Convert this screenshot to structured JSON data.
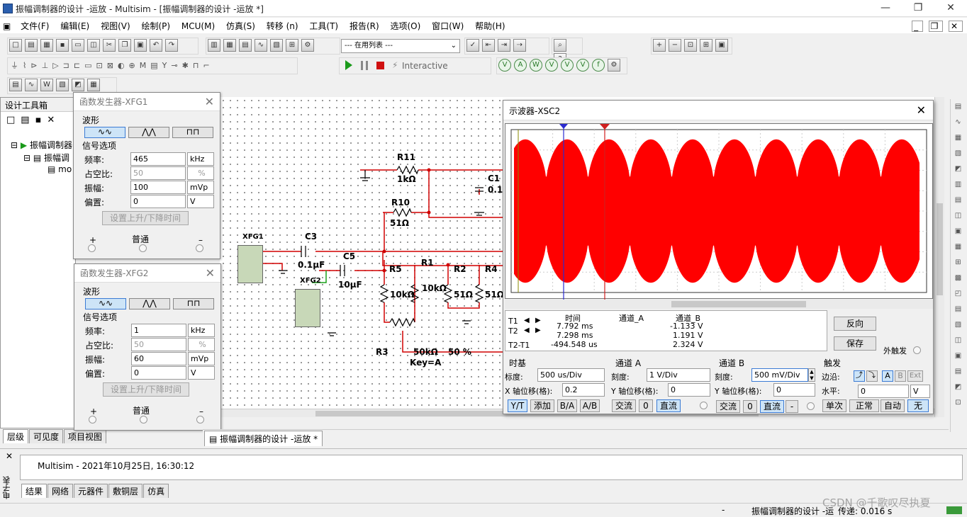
{
  "app": {
    "title": "振幅调制器的设计 -运放 - Multisim - [振幅调制器的设计 -运放 *]"
  },
  "menu": [
    "文件(F)",
    "编辑(E)",
    "视图(V)",
    "绘制(P)",
    "MCU(M)",
    "仿真(S)",
    "转移 (n)",
    "工具(T)",
    "报告(R)",
    "选项(O)",
    "窗口(W)",
    "帮助(H)"
  ],
  "toolbar": {
    "list_select": "--- 在用列表 ---",
    "interactive": "Interactive"
  },
  "left_panel": {
    "title": "设计工具箱",
    "tree": [
      "振幅调制器",
      "振幅调",
      "mo"
    ],
    "tabs": [
      "层级",
      "可见度",
      "项目视图"
    ]
  },
  "xfg1": {
    "title": "函数发生器-XFG1",
    "waveform_label": "波形",
    "signal_label": "信号选项",
    "freq_label": "频率:",
    "freq": "465",
    "freq_unit": "kHz",
    "duty_label": "占空比:",
    "duty": "50",
    "duty_unit": "%",
    "amp_label": "振幅:",
    "amp": "100",
    "amp_unit": "mVp",
    "offset_label": "偏置:",
    "offset": "0",
    "offset_unit": "V",
    "rise_btn": "设置上升/下降时间",
    "plus": "+",
    "common": "普通",
    "minus": "–"
  },
  "xfg2": {
    "title": "函数发生器-XFG2",
    "waveform_label": "波形",
    "signal_label": "信号选项",
    "freq_label": "频率:",
    "freq": "1",
    "freq_unit": "kHz",
    "duty_label": "占空比:",
    "duty": "50",
    "duty_unit": "%",
    "amp_label": "振幅:",
    "amp": "60",
    "amp_unit": "mVp",
    "offset_label": "偏置:",
    "offset": "0",
    "offset_unit": "V",
    "rise_btn": "设置上升/下降时间",
    "plus": "+",
    "common": "普通",
    "minus": "–"
  },
  "schematic": {
    "labels": {
      "r11": "R11",
      "r11v": "1kΩ",
      "c1": "C1",
      "c1v": "0.1",
      "r10": "R10",
      "r10v": "51Ω",
      "c3": "C3",
      "c3v": "0.1μF",
      "c5": "C5",
      "c5v": "10μF",
      "r5": "R5",
      "r5v": "10kΩ",
      "r1": "R1",
      "r1v": "10kΩ",
      "r2": "R2",
      "r2v": "51Ω",
      "r4": "R4",
      "r4v": "51Ω",
      "r3": "R3",
      "r3v": "50kΩ",
      "r3p": "50 %",
      "key": "Key=A",
      "xfg1": "XFG1",
      "xfg2": "XFG2"
    }
  },
  "scope": {
    "title": "示波器-XSC2",
    "t1": "T1",
    "t2": "T2",
    "t2t1": "T2-T1",
    "col_time": "时间",
    "col_a": "通道_A",
    "col_b": "通道_B",
    "rows": [
      {
        "time": "7.792 ms",
        "a": "",
        "b": "-1.133 V"
      },
      {
        "time": "7.298 ms",
        "a": "",
        "b": "1.191 V"
      },
      {
        "time": "-494.548 us",
        "a": "",
        "b": "2.324 V"
      }
    ],
    "reverse_btn": "反向",
    "save_btn": "保存",
    "ext_trig": "外触发",
    "timebase": {
      "title": "时基",
      "scale_label": "标度:",
      "scale": "500 us/Div",
      "xpos_label": "X 轴位移(格):",
      "xpos": "0.2",
      "btns": [
        "Y/T",
        "添加",
        "B/A",
        "A/B"
      ]
    },
    "chA": {
      "title": "通道 A",
      "scale_label": "刻度:",
      "scale": "1 V/Div",
      "ypos_label": "Y 轴位移(格):",
      "ypos": "0",
      "btns": [
        "交流",
        "0",
        "直流"
      ]
    },
    "chB": {
      "title": "通道 B",
      "scale_label": "刻度:",
      "scale": "500 mV/Div",
      "ypos_label": "Y 轴位移(格):",
      "ypos": "0",
      "btns": [
        "交流",
        "0",
        "直流",
        "-"
      ]
    },
    "trigger": {
      "title": "触发",
      "edge_label": "边沿:",
      "level_label": "水平:",
      "level": "0",
      "level_unit": "V",
      "edge_btns": [
        "A",
        "B",
        "Ext"
      ],
      "btns": [
        "单次",
        "正常",
        "自动",
        "无"
      ]
    },
    "trace_color": "#ff0000"
  },
  "doc_tab": "振幅调制器的设计 -运放 *",
  "output": {
    "text": "Multisim  -  2021年10月25日, 16:30:12",
    "tabs": [
      "结果",
      "网络",
      "元器件",
      "敷铜层",
      "仿真"
    ],
    "side_label": "电子表"
  },
  "status": {
    "text": "振幅调制器的设计 -运",
    "extra": "传递: 0.016 s",
    "dash": "-",
    "watermark": "CSDN @千歌叹尽执夏"
  }
}
